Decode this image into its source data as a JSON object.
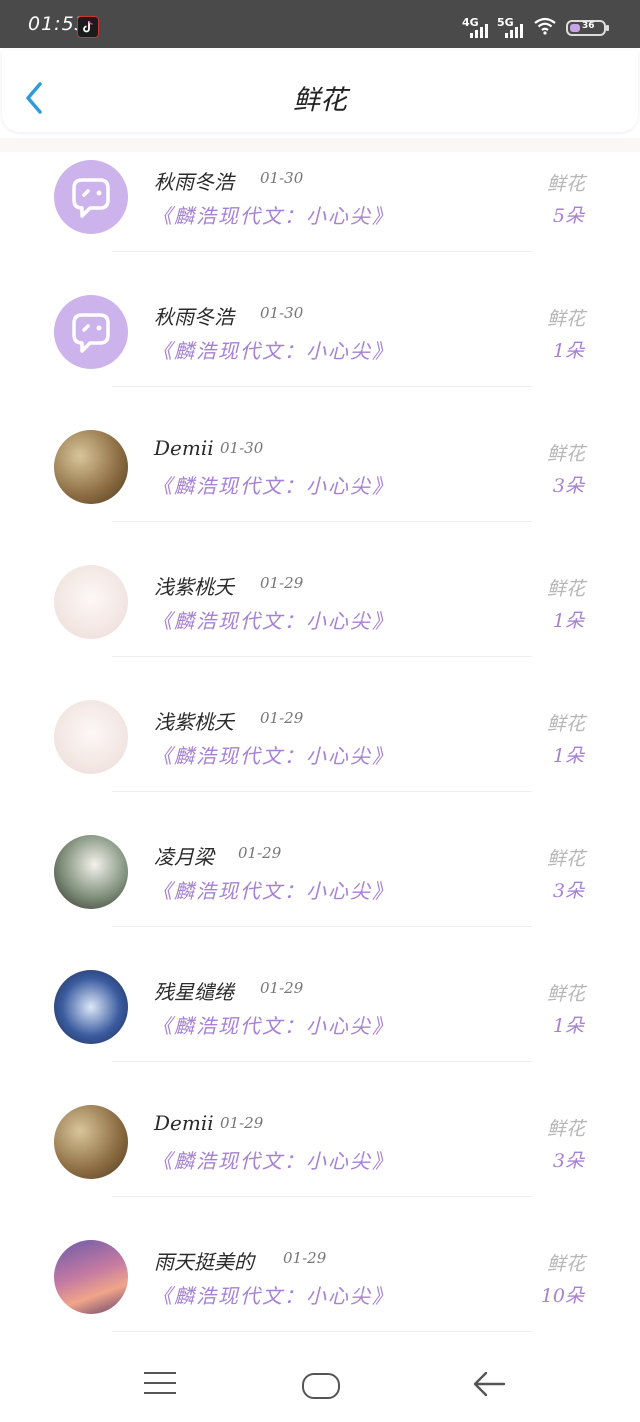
{
  "status_bar": {
    "time": "01:53",
    "network_4g": "4G",
    "network_5g": "5G",
    "battery": "36"
  },
  "header": {
    "title": "鲜花"
  },
  "gift_label": "鲜花",
  "items": [
    {
      "username": "秋雨冬浩",
      "date": "01-30",
      "book": "《麟浩现代文：小心尖》",
      "gift": "鲜花",
      "count": "5朵",
      "avatar": "chat-default"
    },
    {
      "username": "秋雨冬浩",
      "date": "01-30",
      "book": "《麟浩现代文：小心尖》",
      "gift": "鲜花",
      "count": "1朵",
      "avatar": "chat-default"
    },
    {
      "username": "Demii",
      "date": "01-30",
      "book": "《麟浩现代文：小心尖》",
      "gift": "鲜花",
      "count": "3朵",
      "avatar": "photo"
    },
    {
      "username": "浅紫桃夭",
      "date": "01-29",
      "book": "《麟浩现代文：小心尖》",
      "gift": "鲜花",
      "count": "1朵",
      "avatar": "sketch"
    },
    {
      "username": "浅紫桃夭",
      "date": "01-29",
      "book": "《麟浩现代文：小心尖》",
      "gift": "鲜花",
      "count": "1朵",
      "avatar": "sketch"
    },
    {
      "username": "凌月梁",
      "date": "01-29",
      "book": "《麟浩现代文：小心尖》",
      "gift": "鲜花",
      "count": "3朵",
      "avatar": "character"
    },
    {
      "username": "残星缱绻",
      "date": "01-29",
      "book": "《麟浩现代文：小心尖》",
      "gift": "鲜花",
      "count": "1朵",
      "avatar": "blue-art"
    },
    {
      "username": "Demii",
      "date": "01-29",
      "book": "《麟浩现代文：小心尖》",
      "gift": "鲜花",
      "count": "3朵",
      "avatar": "photo"
    },
    {
      "username": "雨天挺美的",
      "date": "01-29",
      "book": "《麟浩现代文：小心尖》",
      "gift": "鲜花",
      "count": "10朵",
      "avatar": "sunset-art"
    }
  ],
  "icons": {
    "back": "chevron-left-icon",
    "menu": "menu-icon",
    "home": "home-icon",
    "nav_back": "back-arrow-icon"
  },
  "colors": {
    "accent": "#a681d4",
    "back_arrow": "#2d9cdb",
    "avatar_default": "#cdb3ec"
  }
}
